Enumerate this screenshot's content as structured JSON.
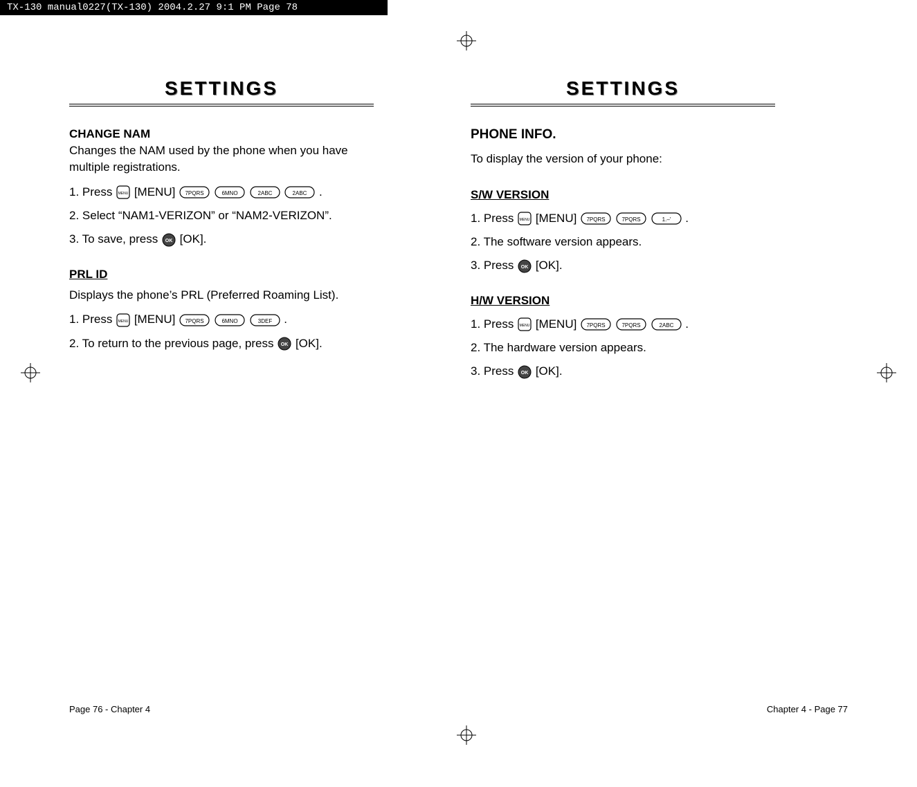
{
  "header_bar": "TX-130 manual0227(TX-130)  2004.2.27  9:1 PM  Page 78",
  "left": {
    "title": "SETTINGS",
    "change_nam_label": "CHANGE NAM",
    "change_nam_desc": "Changes the NAM used by the phone when you have multiple registrations.",
    "cn_step1_pre": "1. Press ",
    "cn_step1_menu": " [MENU] ",
    "cn_step1_end": ".",
    "cn_step2": "2. Select “NAM1-VERIZON” or “NAM2-VERIZON”.",
    "cn_step3_pre": "3. To save, press ",
    "cn_step3_post": " [OK].",
    "prl_label": "PRL ID",
    "prl_desc": "Displays the phone’s PRL (Preferred Roaming List).",
    "prl_step1_pre": "1. Press ",
    "prl_step1_menu": " [MENU] ",
    "prl_step1_end": ".",
    "prl_step2_pre": "2. To return to the previous page, press ",
    "prl_step2_post": " [OK].",
    "footer": "Page 76 - Chapter 4"
  },
  "right": {
    "title": "SETTINGS",
    "phone_info_label": "PHONE INFO.",
    "phone_info_desc": "To display the version of your phone:",
    "sw_label": "S/W VERSION",
    "sw_step1_pre": "1. Press ",
    "sw_step1_menu": " [MENU] ",
    "sw_step1_end": ".",
    "sw_step2": "2. The software version appears.",
    "sw_step3_pre": "3. Press ",
    "sw_step3_post": " [OK].",
    "hw_label": "H/W VERSION",
    "hw_step1_pre": "1. Press ",
    "hw_step1_menu": " [MENU] ",
    "hw_step1_end": ".",
    "hw_step2": "2. The hardware version appears.",
    "hw_step3_pre": "3. Press ",
    "hw_step3_post": " [OK].",
    "footer": "Chapter 4 - Page 77"
  },
  "keys": {
    "menu": "MENU",
    "ok": "OK",
    "k7": "7PQRS",
    "k6": "6MNO",
    "k2": "2ABC",
    "k3": "3DEF",
    "k1": "1.–'"
  }
}
